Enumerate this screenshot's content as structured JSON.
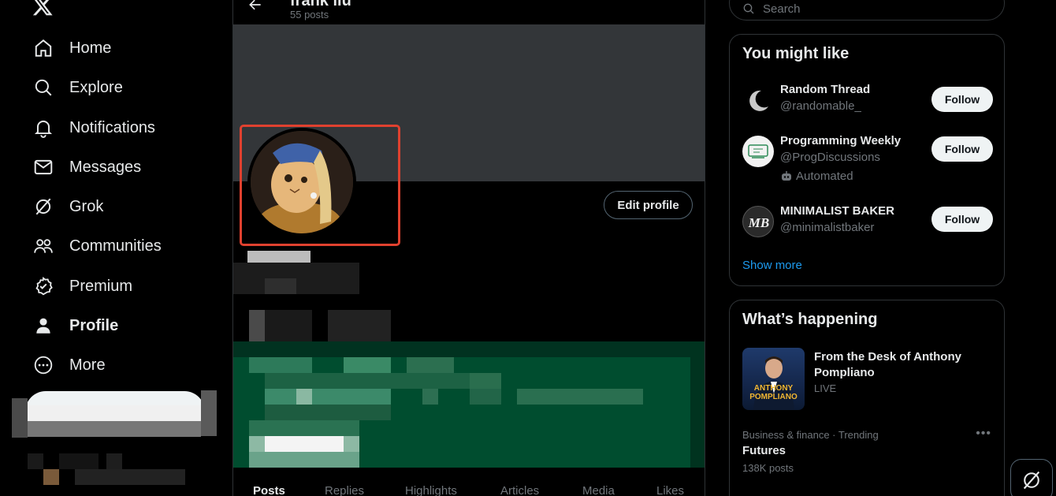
{
  "nav": {
    "items": [
      {
        "label": "Home",
        "icon": "home-icon"
      },
      {
        "label": "Explore",
        "icon": "search-icon"
      },
      {
        "label": "Notifications",
        "icon": "bell-icon"
      },
      {
        "label": "Messages",
        "icon": "envelope-icon"
      },
      {
        "label": "Grok",
        "icon": "grok-icon"
      },
      {
        "label": "Communities",
        "icon": "people-icon"
      },
      {
        "label": "Premium",
        "icon": "verified-badge-icon"
      },
      {
        "label": "Profile",
        "icon": "person-icon"
      },
      {
        "label": "More",
        "icon": "more-circle-icon"
      }
    ]
  },
  "profile": {
    "header_name": "frank liu",
    "posts_count": "55 posts",
    "edit_label": "Edit profile"
  },
  "tabs": [
    "Posts",
    "Replies",
    "Highlights",
    "Articles",
    "Media",
    "Likes"
  ],
  "search": {
    "placeholder": "Search"
  },
  "suggestions": {
    "title": "You might like",
    "follow_label": "Follow",
    "show_more": "Show more",
    "accounts": [
      {
        "name": "Random Thread",
        "handle": "@randomable_"
      },
      {
        "name": "Programming Weekly",
        "handle": "@ProgDiscussions",
        "extra": "Automated"
      },
      {
        "name": "MINIMALIST BAKER",
        "handle": "@minimalistbaker"
      }
    ]
  },
  "happening": {
    "title": "What’s happening",
    "live_title": "From the Desk of Anthony Pompliano",
    "live_status": "LIVE",
    "thumb_text_top": "ANTHONY",
    "thumb_text_bottom": "POMPLIANO",
    "trend": {
      "category": "Business & finance · Trending",
      "name": "Futures",
      "count": "138K posts"
    }
  },
  "colors": {
    "accent": "#1d9bf0",
    "highlight_box": "#e0412f",
    "banner": "#333639",
    "green_block": "#004d2f"
  }
}
